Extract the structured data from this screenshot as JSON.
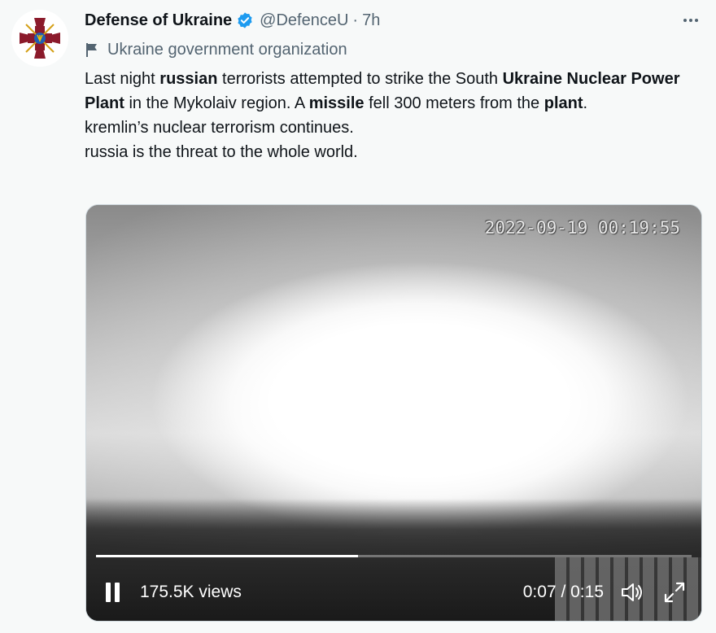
{
  "author": {
    "name": "Defense of Ukraine",
    "handle": "@DefenceU",
    "separator": "·",
    "time": "7h",
    "label": "Ukraine government organization"
  },
  "tweet": {
    "segments": [
      {
        "text": "Last night ",
        "bold": false
      },
      {
        "text": "russian",
        "bold": true
      },
      {
        "text": " terrorists attempted to strike the South ",
        "bold": false
      },
      {
        "text": "Ukraine Nuclear Power Plant",
        "bold": true
      },
      {
        "text": " in the Mykolaiv region. A ",
        "bold": false
      },
      {
        "text": "missile",
        "bold": true
      },
      {
        "text": " fell 300 meters from the ",
        "bold": false
      },
      {
        "text": "plant",
        "bold": true
      },
      {
        "text": ".",
        "bold": false
      }
    ],
    "line2": "kremlin’s nuclear terrorism continues.",
    "line3": "russia is the threat to the whole world."
  },
  "video": {
    "timestamp": "2022-09-19 00:19:55",
    "views": "175.5K views",
    "time_display": "0:07 / 0:15",
    "progress": 0.44
  },
  "icons": {
    "verified": "verified-badge-icon",
    "more": "more-icon",
    "flag": "flag-icon",
    "pause": "pause-icon",
    "volume": "volume-icon",
    "fullscreen": "fullscreen-icon"
  },
  "colors": {
    "brand_red": "#8b1a2b",
    "verified_blue": "#1d9bf0",
    "muted_text": "#536471"
  }
}
